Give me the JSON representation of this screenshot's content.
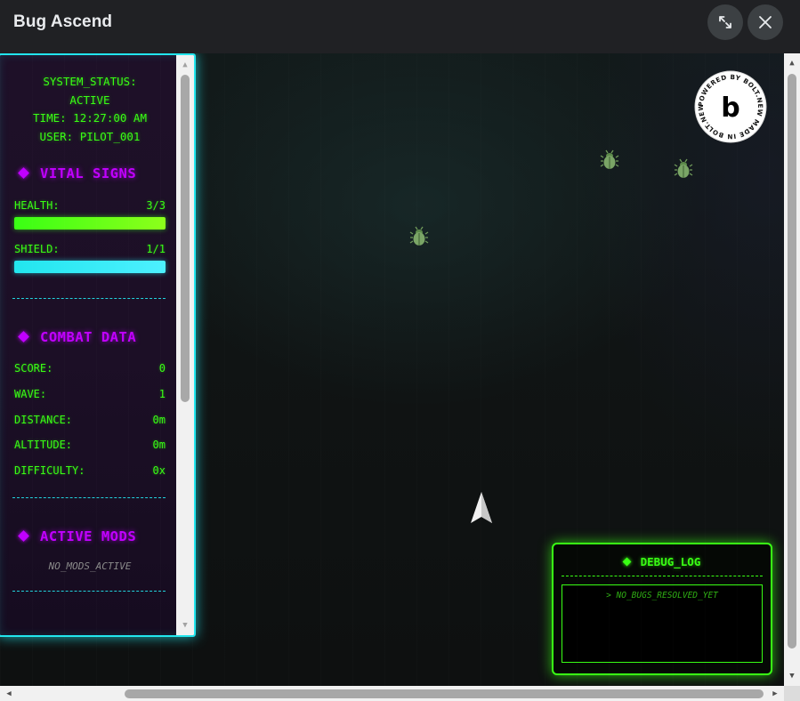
{
  "window": {
    "title": "Bug Ascend",
    "expand_icon": "expand-icon",
    "close_icon": "close-icon"
  },
  "hud": {
    "system_status_label": "SYSTEM_STATUS:",
    "system_status_value": "ACTIVE",
    "time_line": "TIME: 12:27:00 AM",
    "user_line": "USER: PILOT_001",
    "vital_signs": {
      "title": "VITAL SIGNS",
      "health_label": "HEALTH:",
      "health_value": "3/3",
      "health_fill": 1.0,
      "health_color": "#39ff14",
      "shield_label": "SHIELD:",
      "shield_value": "1/1",
      "shield_fill": 1.0,
      "shield_color": "#22e6ee"
    },
    "combat_data": {
      "title": "COMBAT DATA",
      "rows": [
        {
          "label": "SCORE:",
          "value": "0"
        },
        {
          "label": "WAVE:",
          "value": "1"
        },
        {
          "label": "DISTANCE:",
          "value": "0m"
        },
        {
          "label": "ALTITUDE:",
          "value": "0m"
        },
        {
          "label": "DIFFICULTY:",
          "value": "0x"
        }
      ]
    },
    "active_mods": {
      "title": "ACTIVE MODS",
      "empty_text": "NO_MODS_ACTIVE"
    }
  },
  "debug_log": {
    "title": "DEBUG_LOG",
    "lines": [
      "> NO_BUGS_RESOLVED_YET"
    ]
  },
  "badge": {
    "text": "POWERED BY BOLT.NEW MADE IN BOLT.NEW",
    "letter": "b"
  },
  "enemies": [
    "bug-icon",
    "bug-icon",
    "bug-icon"
  ],
  "player": "ship-icon",
  "colors": {
    "accent_green": "#39ff14",
    "accent_cyan": "#22e6ee",
    "accent_purple": "#c100ff"
  }
}
